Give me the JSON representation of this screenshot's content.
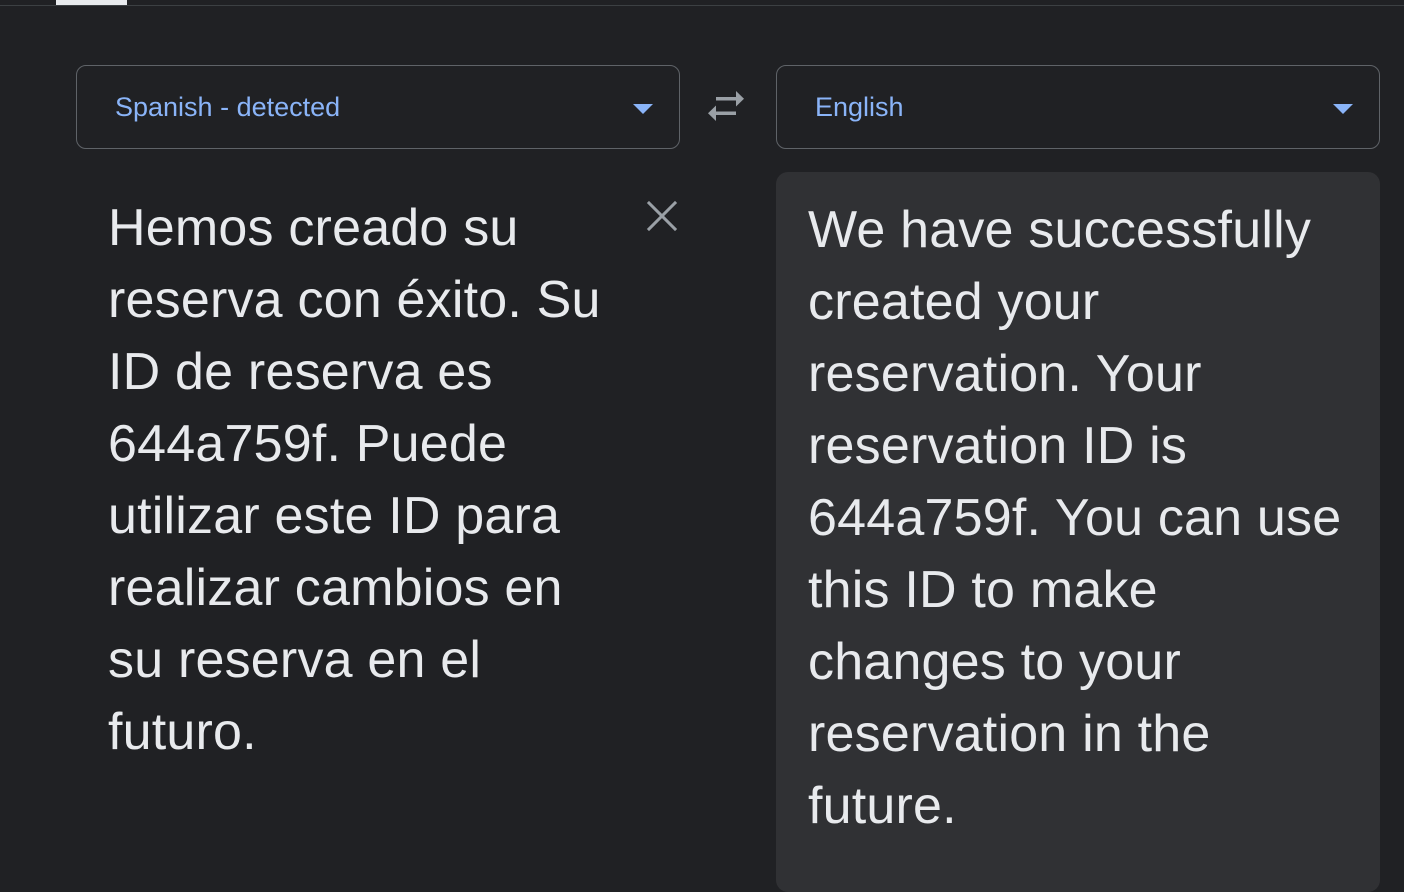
{
  "source_language": {
    "label": "Spanish - detected",
    "dropdown_icon": "arrow-drop-down-icon"
  },
  "swap_icon": "swap-horiz-icon",
  "target_language": {
    "label": "English",
    "dropdown_icon": "arrow-drop-down-icon"
  },
  "source_text": "Hemos creado su reserva con éxito. Su ID de reserva es 644a759f. Puede utilizar este ID para realizar cambios en su reserva en el futuro.",
  "clear_icon": "close-icon",
  "translation_text": "We have successfully created your reservation. Your reservation ID is 644a759f. You can use this ID to make changes to your reservation in the future.",
  "colors": {
    "background": "#202124",
    "panel": "#303134",
    "accent": "#8ab4f8",
    "text": "#e8eaed",
    "border": "#5f6368"
  }
}
